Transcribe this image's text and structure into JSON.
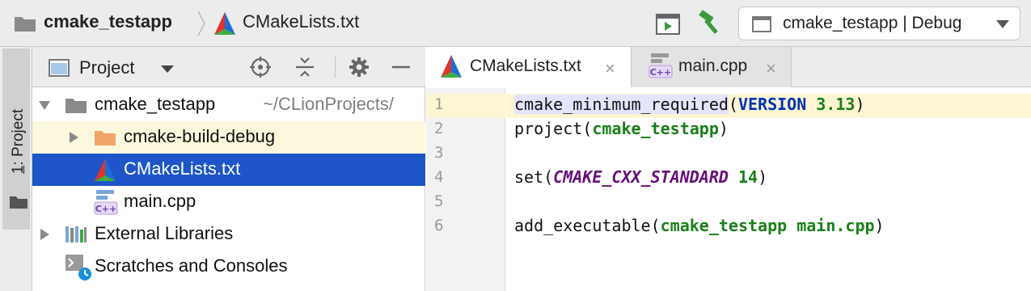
{
  "navbar": {
    "project_name": "cmake_testapp",
    "file_name": "CMakeLists.txt",
    "run_config": "cmake_testapp | Debug"
  },
  "toolstrip": {
    "tab_number": "1",
    "tab_rest": ": Project"
  },
  "project_panel": {
    "title": "Project",
    "tree": {
      "root_name": "cmake_testapp",
      "root_path": "~/CLionProjects/",
      "build_dir": "cmake-build-debug",
      "cmakelists": "CMakeLists.txt",
      "main_cpp": "main.cpp",
      "external_libraries": "External Libraries",
      "scratches": "Scratches and Consoles"
    }
  },
  "editor": {
    "tabs": [
      {
        "label": "CMakeLists.txt",
        "close": "×"
      },
      {
        "label": "main.cpp",
        "close": "×"
      }
    ],
    "line_numbers": [
      "1",
      "2",
      "3",
      "4",
      "5",
      "6"
    ],
    "code": {
      "l1_fn": "cmake_minimum_required",
      "l1_open": "(",
      "l1_kw": "VERSION",
      "l1_space": " ",
      "l1_num": "3.13",
      "l1_close": ")",
      "l2_fn": "project(",
      "l2_arg": "cmake_testapp",
      "l2_close": ")",
      "l4_fn": "set(",
      "l4_var": "CMAKE_CXX_STANDARD",
      "l4_space": " ",
      "l4_num": "14",
      "l4_close": ")",
      "l6_fn": "add_executable(",
      "l6_arg": "cmake_testapp main.cpp",
      "l6_close": ")"
    },
    "icon_badge": "C++"
  },
  "colors": {
    "selection": "#1e55c8",
    "caret_row": "#fcf6d3",
    "keyword": "#0033b3",
    "string_arg": "#1a7f1a",
    "variable": "#660e7a",
    "hammer": "#3d9a3d",
    "build_folder": "#f0a56a"
  }
}
